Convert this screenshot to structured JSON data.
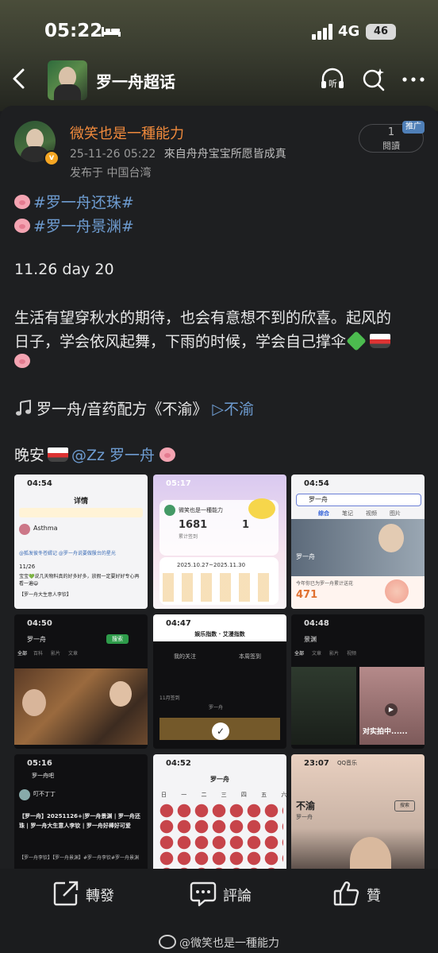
{
  "status_bar": {
    "time": "05:22",
    "network": "4G",
    "battery": "46"
  },
  "nav": {
    "title": "罗一舟超话"
  },
  "post": {
    "username": "微笑也是一種能力",
    "timestamp": "25-11-26 05:22",
    "source": "來自舟舟宝宝所愿皆成真",
    "location": "发布于 中国台湾",
    "read_count": "1",
    "read_label": "閱讀",
    "promo_label": "推广",
    "hashtags": [
      "#罗一舟还珠#",
      "#罗一舟景渊#"
    ],
    "day_line": "11.26 day 20",
    "body_line1": "生活有望穿秋水的期待，也会有意想不到的欣喜。起风的",
    "body_line2": "日子，学会依风起舞，下雨的时候，学会自己撑伞",
    "music_text": "罗一舟/音药配方《不渝》",
    "music_link": "不渝",
    "goodnight": "晚安",
    "mention": "@Zz 罗一舟"
  },
  "thumbnails": [
    {
      "time": "04:54",
      "title": "详情",
      "caption": "Asthma",
      "lines": [
        "@狐发彼冬苍婿记 @罗一舟说要做殷台的星光",
        "11/26",
        "宝宝💚说几天物料真的好多好多，放假一定要好好专心再看一遍😄",
        "【罗一舟大生意人李钦】"
      ]
    },
    {
      "time": "05:17",
      "title": "微笑也是一種能力",
      "caption": "1681",
      "lines": [
        "累计签到",
        "1",
        "2025.10.27~2025.11.30"
      ]
    },
    {
      "time": "04:54",
      "title": "罗一舟",
      "caption": "471",
      "lines": [
        "综合",
        "笔记",
        "视频",
        "图片",
        "罗一舟",
        "今年你已为罗一舟累计送花"
      ]
    },
    {
      "time": "04:50",
      "title": "罗一舟",
      "caption": "搜索",
      "lines": [
        "全部",
        "百科",
        "影片",
        "文章",
        "视频"
      ]
    },
    {
      "time": "04:47",
      "title": "娱乐指数 · 艾漫指数",
      "caption": "11月签到",
      "lines": [
        "我的关注",
        "本周签到",
        "罗一舟"
      ]
    },
    {
      "time": "04:48",
      "title": "景渊",
      "caption": "对实拍中......",
      "lines": [
        "全部",
        "文章",
        "影片",
        "视频"
      ]
    },
    {
      "time": "05:16",
      "title": "罗一舟吧",
      "caption": "叮不丁丁",
      "lines": [
        "【罗一舟】20251126+|罗一舟景渊 | 罗一舟还珠 | 罗一舟大生意人李钦 | 罗一舟好棒好可爱",
        "【罗一舟李钦】【罗一舟景渊】#罗一舟李钦#罗一舟景渊"
      ]
    },
    {
      "time": "04:52",
      "title": "罗一舟",
      "caption": "日 一 二 三 四 五 六",
      "lines": []
    },
    {
      "time": "23:07",
      "title": "QQ音乐",
      "caption": "不渝",
      "lines": [
        "罗一舟",
        "搜索"
      ]
    }
  ],
  "actions": {
    "repost": "轉發",
    "comment": "評論",
    "like": "贊"
  },
  "watermark": "@微笑也是一種能力",
  "colors": {
    "username": "#f08a3c",
    "link": "#6e9cd1",
    "promo": "#4f7fb7"
  }
}
